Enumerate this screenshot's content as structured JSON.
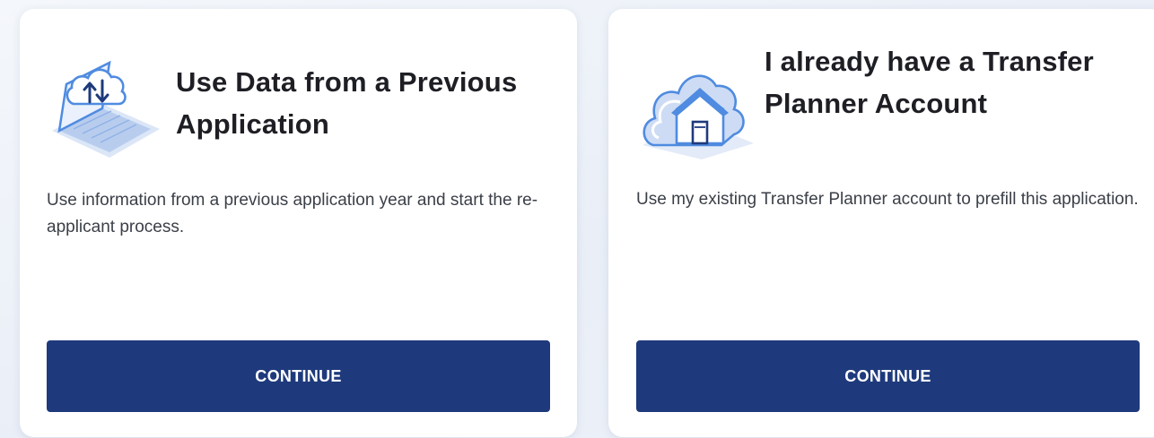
{
  "options": [
    {
      "title": "Use Data from a Previous Application",
      "description": "Use information from a previous application year and start the re-applicant process.",
      "button_label": "CONTINUE",
      "icon": "cloud-laptop-upload-icon"
    },
    {
      "title": "I already have a Transfer Planner Account",
      "description": "Use my existing Transfer Planner account to prefill this application.",
      "button_label": "CONTINUE",
      "icon": "cloud-house-icon"
    }
  ],
  "colors": {
    "button": "#1e3a7c",
    "title": "#1e1f24",
    "text": "#3b3f47",
    "illustration": "#4f8be0"
  }
}
